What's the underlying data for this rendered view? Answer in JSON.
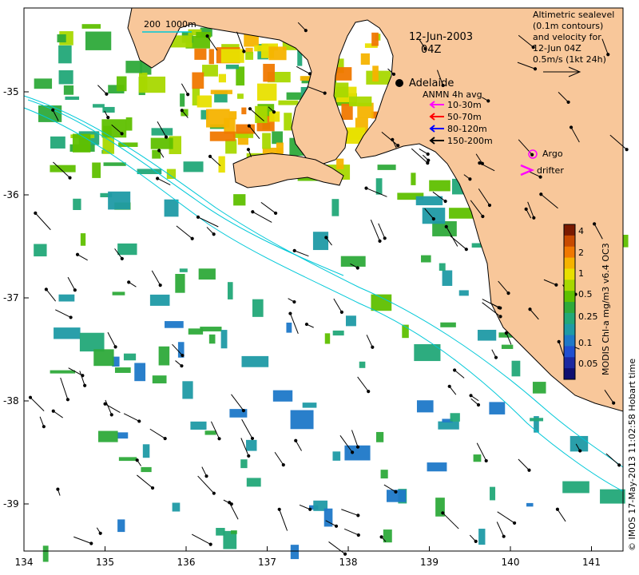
{
  "map": {
    "date_label": "12-Jun-2003",
    "time_label": "04Z",
    "city": "Adelaide",
    "scale_label_1": "200",
    "scale_label_2": "1000m",
    "lon_ticks": [
      "134",
      "135",
      "136",
      "137",
      "138",
      "139",
      "140",
      "141"
    ],
    "lat_ticks": [
      "-35",
      "-36",
      "-37",
      "-38",
      "-39"
    ],
    "sealevel_note": [
      "Altimetric sealevel",
      "(0.1m contours)",
      "and velocity for",
      "12-Jun 04Z",
      "0.5m/s (1kt 24h)"
    ],
    "anmn_title": "ANMN 4h avg",
    "anmn_legend": [
      {
        "label": "10-30m",
        "color": "#ff00ff"
      },
      {
        "label": "50-70m",
        "color": "#ff0000"
      },
      {
        "label": "80-120m",
        "color": "#0000ff"
      },
      {
        "label": "150-200m",
        "color": "#000000"
      }
    ],
    "argo_label": "Argo",
    "drifter_label": "drifter",
    "colorbar": {
      "title": "MODIS Chl-a mg/m3 v6.4 OC3",
      "ticks": [
        "4",
        "2",
        "1",
        "0.5",
        "0.25",
        "0.1",
        "0.05"
      ],
      "colors": [
        "#7a1a00",
        "#c84a00",
        "#f07800",
        "#f5b300",
        "#e8e000",
        "#a8d800",
        "#5fc000",
        "#2eaa3a",
        "#22a878",
        "#1f9aa5",
        "#1e78c8",
        "#1f4fd0",
        "#1a28a0",
        "#0f0f70"
      ]
    },
    "credit": "© IMOS 17-May-2013 11:02:58 Hobart time",
    "colors": {
      "land": "#f8c79a",
      "coastline": "#000000",
      "contour": "#00c8d8",
      "argo": "#ff00ff"
    }
  }
}
